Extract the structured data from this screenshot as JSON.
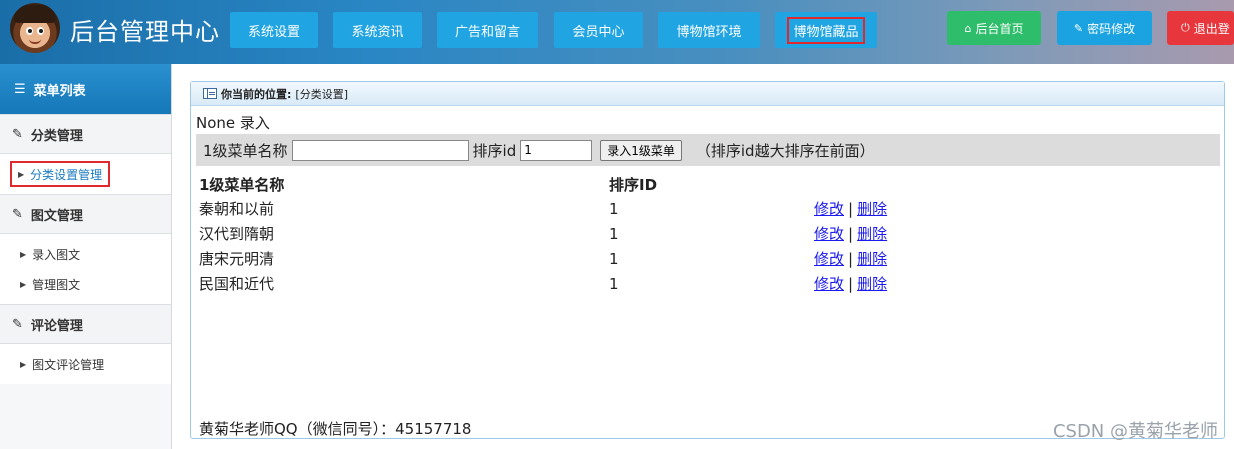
{
  "header": {
    "title": "后台管理中心",
    "nav": [
      {
        "label": "系统设置"
      },
      {
        "label": "系统资讯"
      },
      {
        "label": "广告和留言"
      },
      {
        "label": "会员中心"
      },
      {
        "label": "博物馆环境"
      },
      {
        "label": "博物馆藏品"
      }
    ],
    "buttons": {
      "home": "后台首页",
      "password": "密码修改",
      "logout": "退出登"
    }
  },
  "sidebar": {
    "title": "菜单列表",
    "groups": [
      {
        "label": "分类管理",
        "items": [
          {
            "label": "分类设置管理"
          }
        ]
      },
      {
        "label": "图文管理",
        "items": [
          {
            "label": "录入图文"
          },
          {
            "label": "管理图文"
          }
        ]
      },
      {
        "label": "评论管理",
        "items": [
          {
            "label": "图文评论管理"
          }
        ]
      }
    ]
  },
  "main": {
    "crumb_label": "你当前的位置:",
    "crumb_value": "[分类设置]",
    "none_line": "None 录入",
    "form": {
      "name_label": "1级菜单名称",
      "name_value": "",
      "id_label": "排序id",
      "id_value": "1",
      "submit_label": "录入1级菜单",
      "hint": "（排序id越大排序在前面）"
    },
    "table": {
      "headers": [
        "1级菜单名称",
        "排序ID"
      ],
      "rows": [
        {
          "name": "秦朝和以前",
          "order": "1"
        },
        {
          "name": "汉代到隋朝",
          "order": "1"
        },
        {
          "name": "唐宋元明清",
          "order": "1"
        },
        {
          "name": "民国和近代",
          "order": "1"
        }
      ],
      "edit_label": "修改",
      "separator": "|",
      "delete_label": "删除"
    },
    "footer": "黄菊华老师QQ（微信同号）：45157718"
  },
  "watermark": "CSDN @黄菊华老师",
  "colors": {
    "nav_button": "#21a4e2",
    "home_button": "#2ebd6b",
    "password_button": "#1aa3e0",
    "logout_button": "#e8373c",
    "highlight_border": "#e0282e"
  }
}
